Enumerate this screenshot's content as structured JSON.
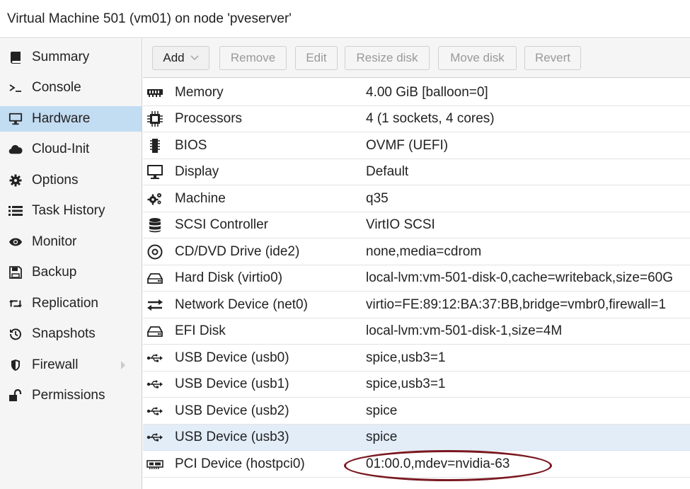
{
  "window": {
    "title": "Virtual Machine 501 (vm01) on node 'pveserver'"
  },
  "sidebar": {
    "items": [
      {
        "label": "Summary",
        "icon": "book-icon"
      },
      {
        "label": "Console",
        "icon": "terminal-icon"
      },
      {
        "label": "Hardware",
        "icon": "monitor-icon",
        "active": true
      },
      {
        "label": "Cloud-Init",
        "icon": "cloud-icon"
      },
      {
        "label": "Options",
        "icon": "gear-icon"
      },
      {
        "label": "Task History",
        "icon": "list-icon"
      },
      {
        "label": "Monitor",
        "icon": "eye-icon"
      },
      {
        "label": "Backup",
        "icon": "floppy-icon"
      },
      {
        "label": "Replication",
        "icon": "retweet-icon"
      },
      {
        "label": "Snapshots",
        "icon": "history-icon"
      },
      {
        "label": "Firewall",
        "icon": "shield-icon",
        "has_submenu": true
      },
      {
        "label": "Permissions",
        "icon": "unlock-icon"
      }
    ]
  },
  "toolbar": {
    "add_label": "Add",
    "remove_label": "Remove",
    "edit_label": "Edit",
    "resize_label": "Resize disk",
    "move_label": "Move disk",
    "revert_label": "Revert"
  },
  "hardware": {
    "rows": [
      {
        "name": "Memory",
        "value": "4.00 GiB [balloon=0]",
        "icon": "memory-icon"
      },
      {
        "name": "Processors",
        "value": "4 (1 sockets, 4 cores)",
        "icon": "cpu-icon"
      },
      {
        "name": "BIOS",
        "value": "OVMF (UEFI)",
        "icon": "microchip-icon"
      },
      {
        "name": "Display",
        "value": "Default",
        "icon": "display-icon"
      },
      {
        "name": "Machine",
        "value": "q35",
        "icon": "cogs-icon"
      },
      {
        "name": "SCSI Controller",
        "value": "VirtIO SCSI",
        "icon": "database-icon"
      },
      {
        "name": "CD/DVD Drive (ide2)",
        "value": "none,media=cdrom",
        "icon": "cdrom-icon"
      },
      {
        "name": "Hard Disk (virtio0)",
        "value": "local-lvm:vm-501-disk-0,cache=writeback,size=60G",
        "icon": "hdd-icon"
      },
      {
        "name": "Network Device (net0)",
        "value": "virtio=FE:89:12:BA:37:BB,bridge=vmbr0,firewall=1",
        "icon": "exchange-icon"
      },
      {
        "name": "EFI Disk",
        "value": "local-lvm:vm-501-disk-1,size=4M",
        "icon": "hdd-icon"
      },
      {
        "name": "USB Device (usb0)",
        "value": "spice,usb3=1",
        "icon": "usb-icon"
      },
      {
        "name": "USB Device (usb1)",
        "value": "spice,usb3=1",
        "icon": "usb-icon"
      },
      {
        "name": "USB Device (usb2)",
        "value": "spice",
        "icon": "usb-icon"
      },
      {
        "name": "USB Device (usb3)",
        "value": "spice",
        "icon": "usb-icon",
        "selected": true
      },
      {
        "name": "PCI Device (hostpci0)",
        "value": "01:00.0,mdev=nvidia-63",
        "icon": "pci-card-icon"
      }
    ]
  },
  "colors": {
    "active_nav": "#c2dcf2",
    "selected_row": "#e3edf8",
    "annotation": "#7a1820"
  }
}
